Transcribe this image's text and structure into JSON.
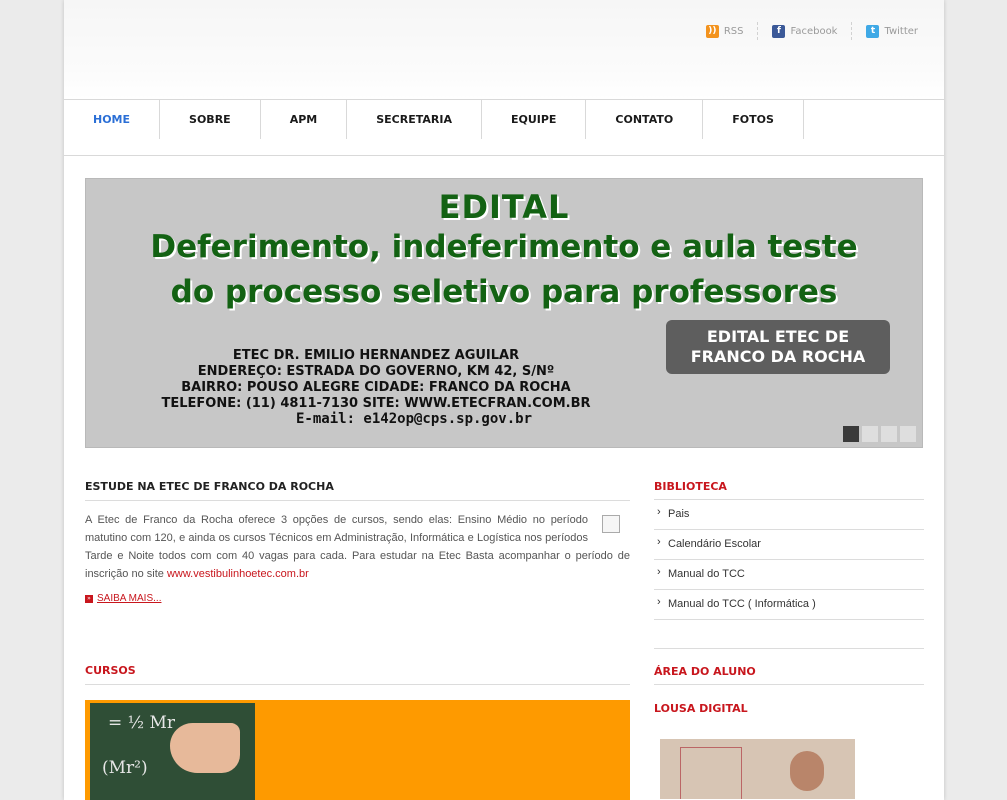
{
  "social": [
    {
      "label": "RSS",
      "icon": "rss-icon"
    },
    {
      "label": "Facebook",
      "icon": "facebook-icon"
    },
    {
      "label": "Twitter",
      "icon": "twitter-icon"
    }
  ],
  "nav": {
    "items": [
      "HOME",
      "SOBRE",
      "APM",
      "SECRETARIA",
      "EQUIPE",
      "CONTATO",
      "FOTOS"
    ],
    "active": "HOME"
  },
  "banner": {
    "heading": "EDITAL",
    "line1": "Deferimento, indeferimento e aula teste",
    "line2": "do processo seletivo para professores",
    "badge_line1": "EDITAL ETEC DE",
    "badge_line2": "FRANCO DA ROCHA",
    "school": "ETEC DR. EMILIO HERNANDEZ AGUILAR",
    "address": "ENDEREÇO: ESTRADA DO GOVERNO, KM 42, S/Nº",
    "district": "BAIRRO: POUSO ALEGRE CIDADE: FRANCO DA ROCHA",
    "phone_site": "TELEFONE: (11) 4811-7130    SITE: WWW.ETECFRAN.COM.BR",
    "email": "E-mail: e142op@cps.sp.gov.br",
    "slides": 4,
    "current_slide": 1
  },
  "main": {
    "title": "ESTUDE NA ETEC DE FRANCO DA ROCHA",
    "text": "A Etec de Franco da Rocha oferece 3 opções de cursos, sendo elas: Ensino Médio no período matutino com 120, e ainda os cursos Técnicos em Administração, Informática e Logística nos períodos Tarde e Noite todos com com 40 vagas para cada. Para estudar na Etec Basta acompanhar o período de inscrição no site ",
    "link": "www.vestibulinhoetec.com.br",
    "more": "SAIBA MAIS...",
    "cursos_title": "CURSOS"
  },
  "sidebar": {
    "biblioteca_title": "BIBLIOTECA",
    "biblioteca_items": [
      "Pais",
      "Calendário Escolar",
      "Manual do TCC",
      "Manual do TCC ( Informática )"
    ],
    "area_title": "ÁREA DO ALUNO",
    "lousa_title": "LOUSA DIGITAL"
  },
  "colors": {
    "accent_red": "#c8161d",
    "nav_active": "#2b6fd6",
    "cursos_bg": "#fe9a00",
    "banner_green": "#136213"
  }
}
